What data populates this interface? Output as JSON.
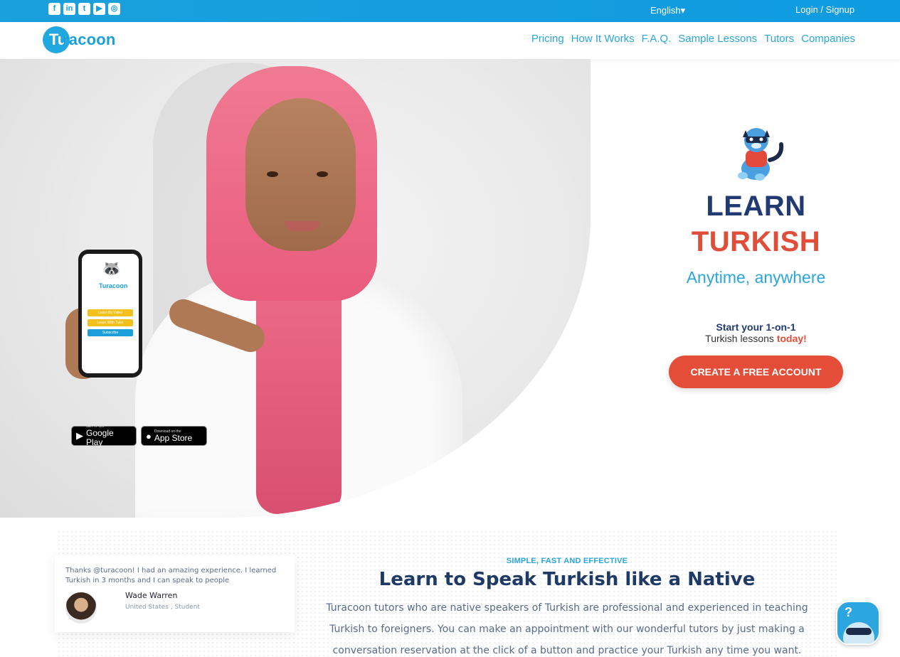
{
  "topbar": {
    "social": [
      {
        "icon": "facebook-icon",
        "glyph": "f"
      },
      {
        "icon": "linkedin-icon",
        "glyph": "in"
      },
      {
        "icon": "twitter-icon",
        "glyph": "t"
      },
      {
        "icon": "youtube-icon",
        "glyph": "▶"
      },
      {
        "icon": "instagram-icon",
        "glyph": "◎"
      }
    ],
    "language": "English",
    "login_label": "Login / Signup"
  },
  "navbar": {
    "logo_tu": "Tu",
    "logo_rest": "racoon",
    "links": [
      "Pricing",
      "How It Works",
      "F.A.Q.",
      "Sample Lessons",
      "Tutors",
      "Companies"
    ]
  },
  "hero": {
    "phone": {
      "logo": "Turacoon",
      "buttons": [
        "Learn By Video",
        "Learn With Tutor",
        "Subscribe"
      ]
    },
    "badges": {
      "google_small": "GET IT ON",
      "google_big": "Google Play",
      "apple_small": "Download on the",
      "apple_big": "App Store"
    },
    "title_line1": "LEARN",
    "title_line2": "TURKISH",
    "tagline": "Anytime, anywhere",
    "start_line1": "Start your 1-on-1",
    "start_line2": "Turkish lessons",
    "start_today": "today!",
    "cta_label": "CREATE A FREE ACCOUNT"
  },
  "testimonial": {
    "quote": "Thanks @turacoon! I had an amazing experience. I learned Turkish in 3 months and I can speak to people",
    "name": "Wade Warren",
    "location": "United States , Student"
  },
  "section": {
    "kicker": "SIMPLE, FAST AND EFFECTIVE",
    "headline": "Learn to Speak Turkish like a Native",
    "paragraph": "Turacoon tutors who are native speakers of Turkish are professional and experienced in teaching Turkish to foreigners. You can make an appointment with our wonderful tutors by just making a conversation reservation at the click of a button and practice your Turkish any time you want."
  },
  "help_widget": {
    "icon": "question-raccoon-icon",
    "glyph": "?"
  },
  "colors": {
    "brand_blue": "#1b9fdb",
    "navy": "#213a72",
    "accent_red": "#e44e39"
  }
}
